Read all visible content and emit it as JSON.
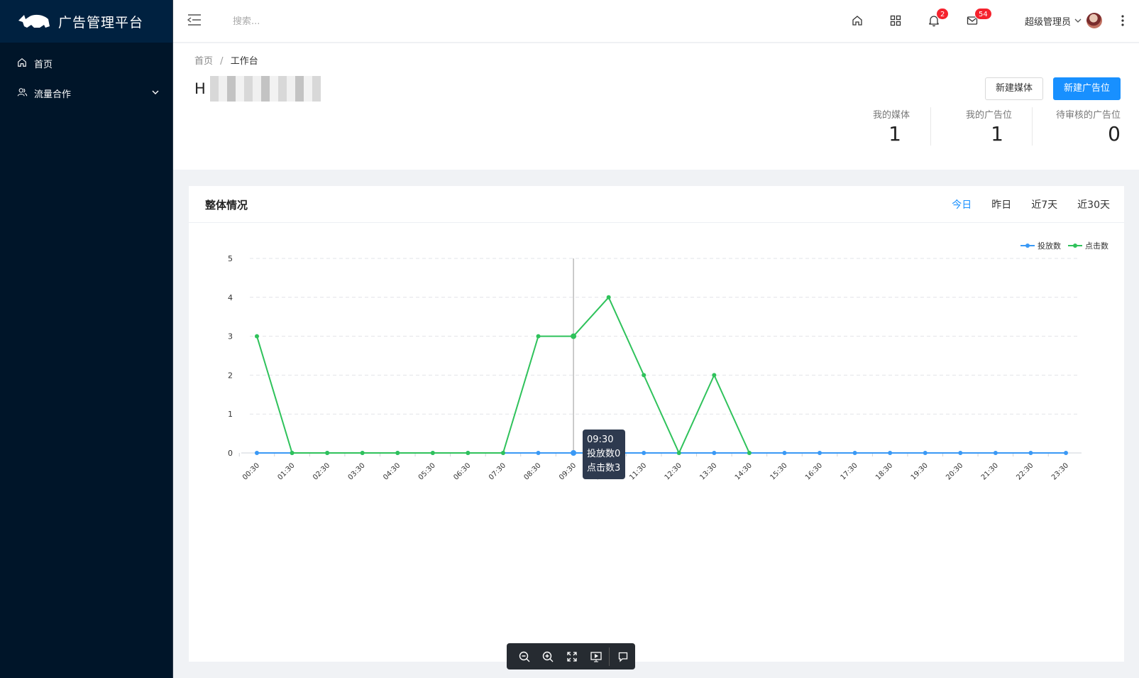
{
  "app": {
    "title": "广告管理平台"
  },
  "sidebar": {
    "items": [
      {
        "label": "首页",
        "icon": "home-icon"
      },
      {
        "label": "流量合作",
        "icon": "users-icon",
        "expandable": true
      }
    ]
  },
  "header": {
    "search_placeholder": "搜索...",
    "notifications_count": "2",
    "messages_count": "54",
    "user_name": "超级管理员"
  },
  "breadcrumb": {
    "root": "首页",
    "current": "工作台"
  },
  "welcome": {
    "prefix": "H"
  },
  "actions": {
    "new_media": "新建媒体",
    "new_ad_slot": "新建广告位"
  },
  "stats": [
    {
      "label": "我的媒体",
      "value": "1"
    },
    {
      "label": "我的广告位",
      "value": "1"
    },
    {
      "label": "待审核的广告位",
      "value": "0"
    }
  ],
  "overview": {
    "title": "整体情况",
    "tabs": [
      "今日",
      "昨日",
      "近7天",
      "近30天"
    ],
    "active_tab": "今日"
  },
  "tooltip": {
    "time": "09:30",
    "line1": "投放数0",
    "line2": "点击数3"
  },
  "colors": {
    "primary": "#1890ff",
    "series_impressions": "#3a99f5",
    "series_clicks": "#2fc25b",
    "sidebar": "#001529"
  },
  "chart_data": {
    "type": "line",
    "x": [
      "00:30",
      "01:30",
      "02:30",
      "03:30",
      "04:30",
      "05:30",
      "06:30",
      "07:30",
      "08:30",
      "09:30",
      "10:30",
      "11:30",
      "12:30",
      "13:30",
      "14:30",
      "15:30",
      "16:30",
      "17:30",
      "18:30",
      "19:30",
      "20:30",
      "21:30",
      "22:30",
      "23:30"
    ],
    "series": [
      {
        "name": "投放数",
        "values": [
          0,
          0,
          0,
          0,
          0,
          0,
          0,
          0,
          0,
          0,
          0,
          0,
          0,
          0,
          0,
          0,
          0,
          0,
          0,
          0,
          0,
          0,
          0,
          0
        ]
      },
      {
        "name": "点击数",
        "values": [
          3,
          0,
          0,
          0,
          0,
          0,
          0,
          0,
          3,
          3,
          4,
          2,
          0,
          2,
          0,
          null,
          null,
          null,
          null,
          null,
          null,
          null,
          null,
          null
        ]
      }
    ],
    "ylim": [
      0,
      5
    ],
    "yticks": [
      0,
      1,
      2,
      3,
      4,
      5
    ],
    "grid": true,
    "legend": "top-right",
    "highlighted_x": "09:30"
  },
  "toolbar": {
    "buttons": [
      "zoom-out-icon",
      "zoom-in-icon",
      "fit-screen-icon",
      "present-icon",
      "comment-icon"
    ]
  }
}
